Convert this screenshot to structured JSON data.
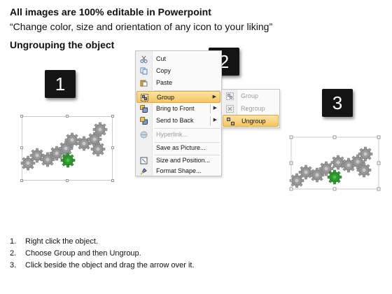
{
  "header": {
    "title": "All images are 100% editable in Powerpoint",
    "subtitle": "“Change color, size and orientation of any icon to your liking”",
    "section": "Ungrouping the object"
  },
  "badges": [
    "1",
    "2",
    "3"
  ],
  "context_menu": {
    "items": [
      {
        "label": "Cut",
        "icon": "scissors-icon"
      },
      {
        "label": "Copy",
        "icon": "copy-icon"
      },
      {
        "label": "Paste",
        "icon": "paste-icon"
      },
      {
        "label": "Group",
        "icon": "group-icon",
        "highlighted": true,
        "submenu": true
      },
      {
        "label": "Bring to Front",
        "icon": "bring-to-front-icon",
        "submenu": true
      },
      {
        "label": "Send to Back",
        "icon": "send-to-back-icon",
        "submenu": true
      },
      {
        "label": "Hyperlink...",
        "icon": "hyperlink-icon",
        "disabled": true
      },
      {
        "label": "Save as Picture...",
        "icon": null
      },
      {
        "label": "Size and Position...",
        "icon": "size-position-icon"
      },
      {
        "label": "Format Shape...",
        "icon": "format-shape-icon"
      }
    ]
  },
  "submenu": {
    "items": [
      {
        "label": "Group",
        "icon": "group-icon",
        "disabled": true
      },
      {
        "label": "Regroup",
        "icon": "regroup-icon",
        "disabled": true
      },
      {
        "label": "Ungroup",
        "icon": "ungroup-icon",
        "highlighted": true
      }
    ]
  },
  "colors": {
    "gear_gray": "#9a9a9a",
    "gear_green": "#2f9a2f",
    "highlight": "#f6c55e"
  },
  "steps": [
    {
      "num": "1.",
      "text": "Right click the object."
    },
    {
      "num": "2.",
      "text": "Choose Group and then Ungroup."
    },
    {
      "num": "3.",
      "text": "Click beside the object and drag the arrow over it."
    }
  ]
}
